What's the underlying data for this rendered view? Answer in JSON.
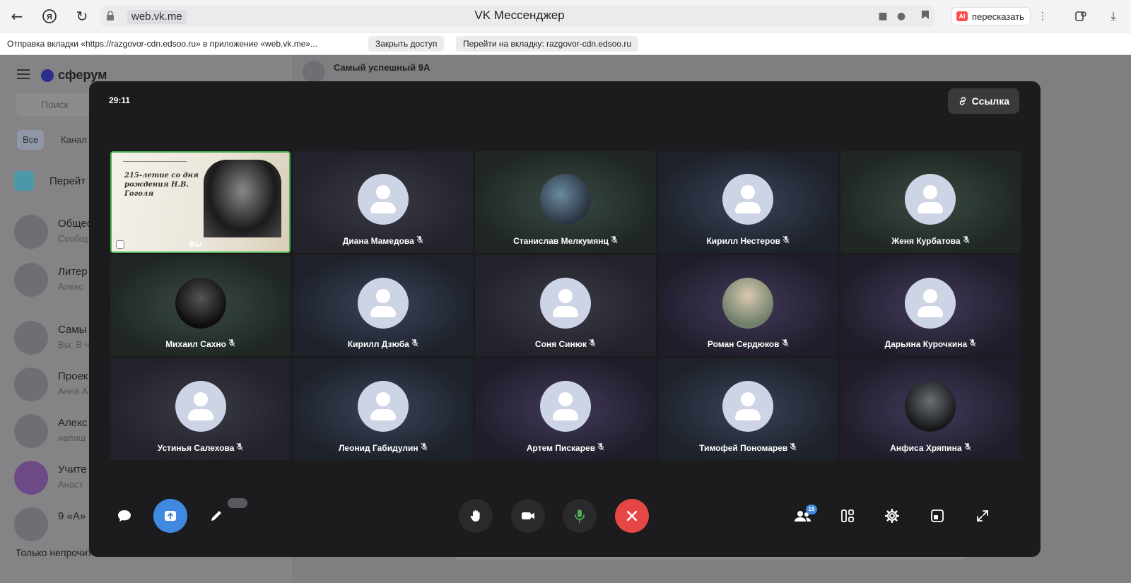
{
  "browser": {
    "url": "web.vk.me",
    "page_title": "VK Мессенджер",
    "retell_label": "пересказать",
    "retell_badge": "AI"
  },
  "share_bar": {
    "message": "Отправка вкладки «https://razgovor-cdn.edsoo.ru» в приложение «web.vk.me»...",
    "close_access": "Закрыть доступ",
    "go_to_tab": "Перейти на вкладку: razgovor-cdn.edsoo.ru"
  },
  "background_app": {
    "logo": "сферум",
    "search_placeholder": "Поиск",
    "tabs": [
      "Все",
      "Канал"
    ],
    "rows": [
      {
        "title": "Перейт",
        "sub": ""
      },
      {
        "title": "Общеc",
        "sub": "Сообщ"
      },
      {
        "title": "Литер",
        "sub": "Алекс"
      },
      {
        "title": "Самы",
        "sub": "Вы: В ч"
      },
      {
        "title": "Проек",
        "sub": "Анна А"
      },
      {
        "title": "Алекс",
        "sub": "напиш"
      },
      {
        "title": "Учите",
        "sub": "Анаст"
      },
      {
        "title": "9 «А»",
        "sub": ""
      }
    ],
    "unread_only": "Только непрочитанные",
    "chat_title": "Самый успешный 9А"
  },
  "call": {
    "timer": "29:11",
    "link_label": "Ссылка",
    "self": {
      "name": "Вы",
      "slide_title": "215-летие со дня рождения Н.В. Гоголя"
    },
    "participants": [
      {
        "name": "Диана Мамедова",
        "tone": "n",
        "photo": ""
      },
      {
        "name": "Станислав Мелкумянц",
        "tone": "g",
        "photo": "photo1"
      },
      {
        "name": "Кирилл Нестеров",
        "tone": "b",
        "photo": ""
      },
      {
        "name": "Женя Курбатова",
        "tone": "g",
        "photo": ""
      },
      {
        "name": "Михаил Сахно",
        "tone": "g",
        "photo": "photo2"
      },
      {
        "name": "Кирилл Дзюба",
        "tone": "b",
        "photo": ""
      },
      {
        "name": "Соня Синюк",
        "tone": "n",
        "photo": ""
      },
      {
        "name": "Роман Сердюков",
        "tone": "p",
        "photo": "photo3"
      },
      {
        "name": "Дарьяна Курочкина",
        "tone": "p",
        "photo": ""
      },
      {
        "name": "Устинья Салехова",
        "tone": "n",
        "photo": ""
      },
      {
        "name": "Леонид Габидулин",
        "tone": "b",
        "photo": ""
      },
      {
        "name": "Артем Пискарев",
        "tone": "p",
        "photo": ""
      },
      {
        "name": "Тимофей Пономарев",
        "tone": "b",
        "photo": ""
      },
      {
        "name": "Анфиса Хряпина",
        "tone": "p",
        "photo": "photo4"
      }
    ],
    "participants_badge": "15"
  },
  "colors": {
    "modal_bg": "#1c1c1e",
    "accent_blue": "#3f8ae0",
    "end_call_red": "#e64646",
    "self_border": "#4caf50",
    "mic_green": "#4caf50"
  }
}
